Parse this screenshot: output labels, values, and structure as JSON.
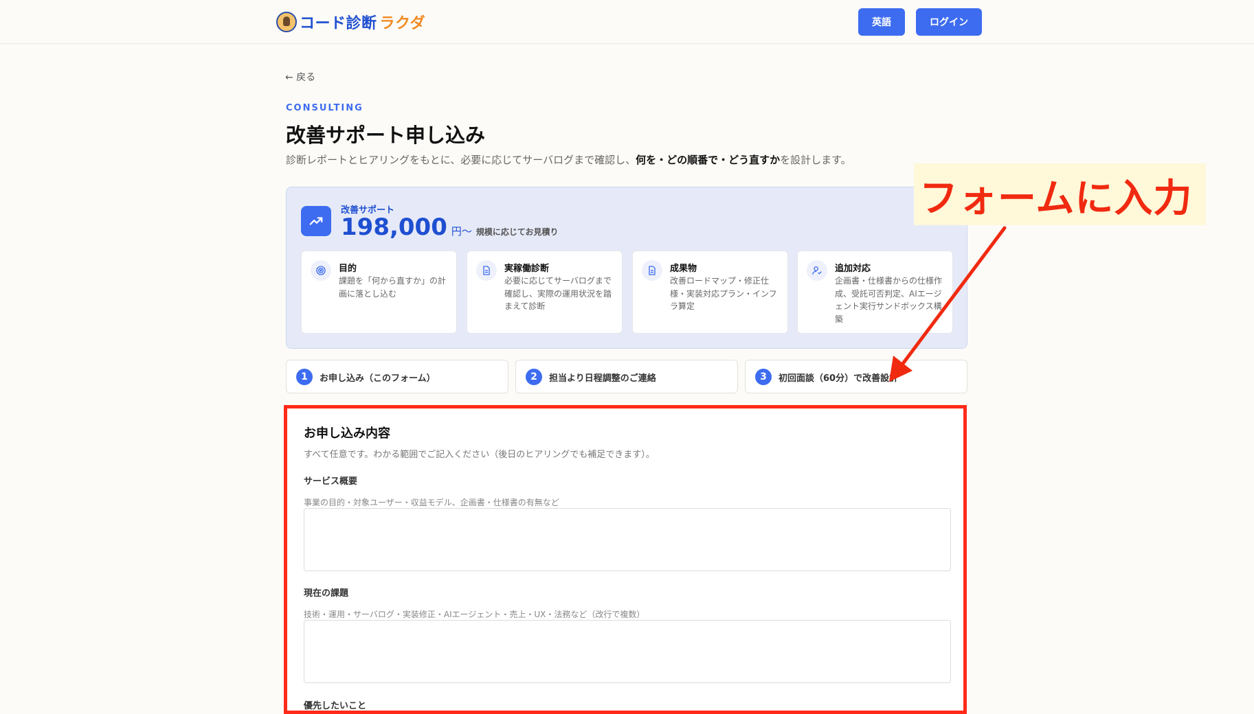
{
  "header": {
    "logo_main": "コード診断",
    "logo_accent": "ラクダ",
    "lang_button": "英語",
    "login_button": "ログイン"
  },
  "back_link": "← 戻る",
  "eyebrow": "CONSULTING",
  "title": "改善サポート申し込み",
  "lead": {
    "before": "診断レポートとヒアリングをもとに、必要に応じてサーバログまで確認し、",
    "bold": "何を・どの順番で・どう直すか",
    "after": "を設計します。"
  },
  "plan": {
    "label": "改善サポート",
    "price": "198,000",
    "unit": "円〜",
    "note": "規模に応じてお見積り",
    "features": [
      {
        "icon": "target-icon",
        "title": "目的",
        "desc": "課題を「何から直すか」の計画に落とし込む"
      },
      {
        "icon": "document-icon",
        "title": "実稼働診断",
        "desc": "必要に応じてサーバログまで確認し、実際の運用状況を踏まえて診断"
      },
      {
        "icon": "document-icon",
        "title": "成果物",
        "desc": "改善ロードマップ・修正仕様・実装対応プラン・インフラ算定"
      },
      {
        "icon": "user-check-icon",
        "title": "追加対応",
        "desc": "企画書・仕様書からの仕様作成、受託可否判定、AIエージェント実行サンドボックス構築"
      }
    ]
  },
  "steps": [
    {
      "num": "1",
      "label": "お申し込み（このフォーム）"
    },
    {
      "num": "2",
      "label": "担当より日程調整のご連絡"
    },
    {
      "num": "3",
      "label": "初回面談（60分）で改善設計"
    }
  ],
  "form": {
    "title": "お申し込み内容",
    "subtitle": "すべて任意です。わかる範囲でご記入ください（後日のヒアリングでも補足できます）。",
    "fields": [
      {
        "label": "サービス概要",
        "hint": "事業の目的・対象ユーザー・収益モデル、企画書・仕様書の有無など",
        "value": ""
      },
      {
        "label": "現在の課題",
        "hint": "技術・運用・サーバログ・実装修正・AIエージェント・売上・UX・法務など（改行で複数）",
        "value": ""
      },
      {
        "label": "優先したいこと"
      }
    ]
  },
  "callout": "フォームに入力",
  "colors": {
    "accent": "#3d6cf0",
    "highlight": "#ff2a1a",
    "brand_orange": "#f08a24"
  }
}
